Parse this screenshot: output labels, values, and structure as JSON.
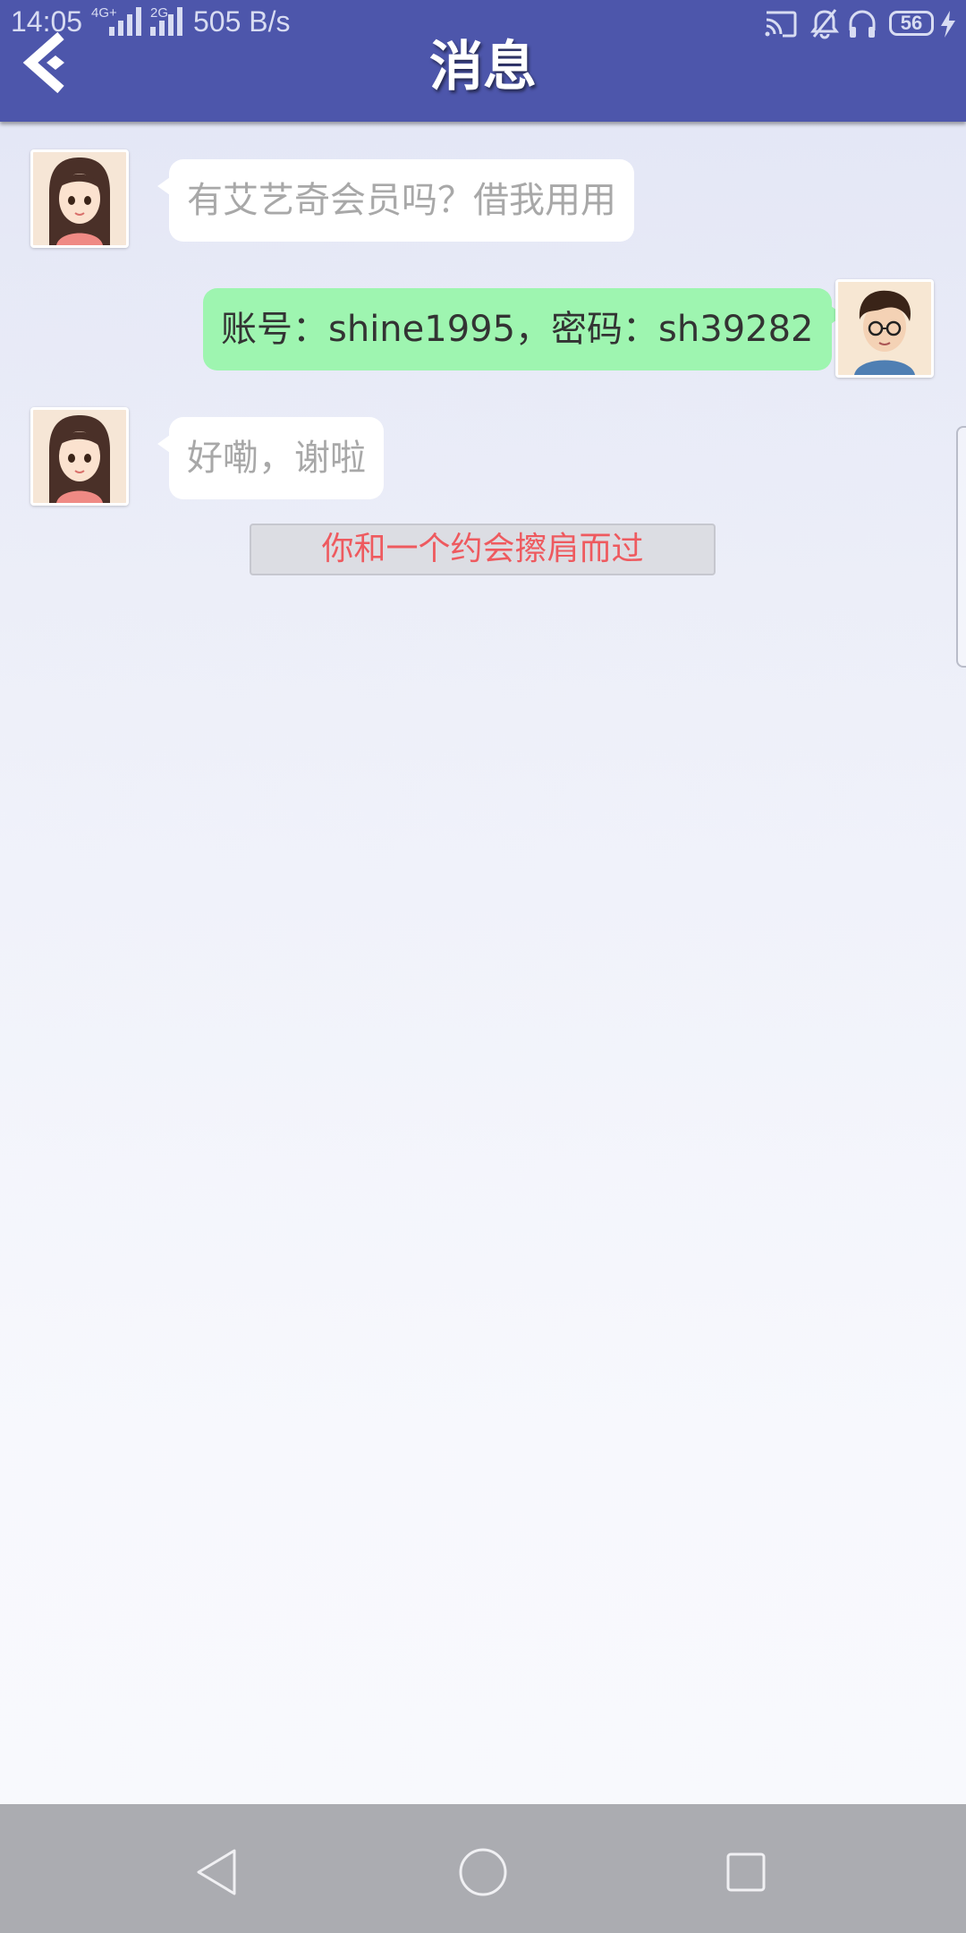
{
  "status_bar": {
    "time": "14:05",
    "network_4g": "4G+",
    "network_2g": "2G",
    "speed": "505 B/s",
    "battery": "56"
  },
  "header": {
    "title": "消息",
    "back_icon": "back-chevron-icon"
  },
  "messages": [
    {
      "sender": "other",
      "avatar": "girl-avatar",
      "text": "有艾艺奇会员吗？借我用用"
    },
    {
      "sender": "me",
      "avatar": "boy-avatar",
      "text": "账号：shine1995，密码：sh39282"
    },
    {
      "sender": "other",
      "avatar": "girl-avatar",
      "text": "好嘞，谢啦"
    }
  ],
  "system_notice": "你和一个约会擦肩而过",
  "nav_bar": {
    "back": "nav-back-icon",
    "home": "nav-home-icon",
    "recents": "nav-recents-icon"
  },
  "colors": {
    "header": "#4d56ab",
    "sent_bubble": "#9ef5b0",
    "received_bubble": "#ffffff",
    "notice_text": "#ee5a5f",
    "nav_bar": "#abacb1"
  }
}
